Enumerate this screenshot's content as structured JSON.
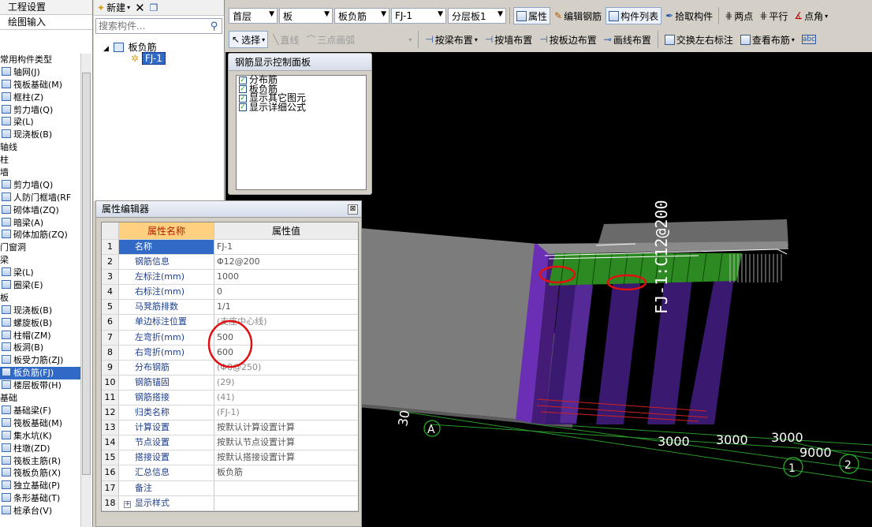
{
  "left_panel": {
    "tabs": [
      "工程设置",
      "绘图输入"
    ],
    "items": [
      {
        "label": "常用构件类型",
        "type": "cat"
      },
      {
        "label": "轴网(J)",
        "type": "item"
      },
      {
        "label": "筏板基础(M)",
        "type": "item"
      },
      {
        "label": "框柱(Z)",
        "type": "item"
      },
      {
        "label": "剪力墙(Q)",
        "type": "item"
      },
      {
        "label": "梁(L)",
        "type": "item"
      },
      {
        "label": "现浇板(B)",
        "type": "item"
      },
      {
        "label": "轴线",
        "type": "cat"
      },
      {
        "label": "柱",
        "type": "cat"
      },
      {
        "label": "墙",
        "type": "cat"
      },
      {
        "label": "剪力墙(Q)",
        "type": "item"
      },
      {
        "label": "人防门框墙(RF",
        "type": "item"
      },
      {
        "label": "砌体墙(ZQ)",
        "type": "item"
      },
      {
        "label": "暗梁(A)",
        "type": "item"
      },
      {
        "label": "砌体加筋(ZQ)",
        "type": "item"
      },
      {
        "label": "门窗洞",
        "type": "cat"
      },
      {
        "label": "梁",
        "type": "cat"
      },
      {
        "label": "梁(L)",
        "type": "item"
      },
      {
        "label": "圈梁(E)",
        "type": "item"
      },
      {
        "label": "板",
        "type": "cat"
      },
      {
        "label": "现浇板(B)",
        "type": "item"
      },
      {
        "label": "螺旋板(B)",
        "type": "item"
      },
      {
        "label": "柱帽(ZM)",
        "type": "item"
      },
      {
        "label": "板洞(B)",
        "type": "item"
      },
      {
        "label": "板受力筋(ZJ)",
        "type": "item"
      },
      {
        "label": "板负筋(FJ)",
        "type": "item",
        "selected": true
      },
      {
        "label": "楼层板带(H)",
        "type": "item"
      },
      {
        "label": "基础",
        "type": "cat"
      },
      {
        "label": "基础梁(F)",
        "type": "item"
      },
      {
        "label": "筏板基础(M)",
        "type": "item"
      },
      {
        "label": "集水坑(K)",
        "type": "item"
      },
      {
        "label": "柱墩(ZD)",
        "type": "item"
      },
      {
        "label": "筏板主筋(R)",
        "type": "item"
      },
      {
        "label": "筏板负筋(X)",
        "type": "item"
      },
      {
        "label": "独立基础(P)",
        "type": "item"
      },
      {
        "label": "条形基础(T)",
        "type": "item"
      },
      {
        "label": "桩承台(V)",
        "type": "item"
      }
    ]
  },
  "tree_panel": {
    "new_label": "新建",
    "search_placeholder": "搜索构件...",
    "root": "板负筋",
    "child": "FJ-1"
  },
  "toolbar1": {
    "floor": "首层",
    "type": "板",
    "subtype": "板负筋",
    "component": "FJ-1",
    "layer": "分层板1",
    "attributes": "属性",
    "edit_rebar": "编辑钢筋",
    "component_list": "构件列表",
    "pick_component": "拾取构件",
    "two_points": "两点",
    "parallel": "平行",
    "point_angle": "点角"
  },
  "toolbar2": {
    "select": "选择",
    "line": "直线",
    "arc": "三点画弧",
    "by_beam": "按梁布置",
    "by_wall": "按墙布置",
    "by_slab_edge": "按板边布置",
    "draw_line": "画线布置",
    "swap_marks": "交换左右标注",
    "view_layout": "查看布筋"
  },
  "rebar_panel": {
    "title": "钢筋显示控制面板",
    "options": [
      "分布筋",
      "板负筋",
      "显示其它图元",
      "显示详细公式"
    ]
  },
  "property_editor": {
    "title": "属性编辑器",
    "col_name": "属性名称",
    "col_value": "属性值",
    "rows": [
      {
        "n": "1",
        "k": "名称",
        "v": "FJ-1",
        "sel": true
      },
      {
        "n": "2",
        "k": "钢筋信息",
        "v": "Φ12@200"
      },
      {
        "n": "3",
        "k": "左标注(mm)",
        "v": "1000"
      },
      {
        "n": "4",
        "k": "右标注(mm)",
        "v": "0"
      },
      {
        "n": "5",
        "k": "马凳筋排数",
        "v": "1/1"
      },
      {
        "n": "6",
        "k": "单边标注位置",
        "v": "(支座中心线)",
        "gray": true
      },
      {
        "n": "7",
        "k": "左弯折(mm)",
        "v": "500"
      },
      {
        "n": "8",
        "k": "右弯折(mm)",
        "v": "600"
      },
      {
        "n": "9",
        "k": "分布钢筋",
        "v": "(Φ8@250)",
        "gray": true
      },
      {
        "n": "10",
        "k": "钢筋锚固",
        "v": "(29)",
        "gray": true
      },
      {
        "n": "11",
        "k": "钢筋搭接",
        "v": "(41)",
        "gray": true
      },
      {
        "n": "12",
        "k": "归类名称",
        "v": "(FJ-1)",
        "gray": true
      },
      {
        "n": "13",
        "k": "计算设置",
        "v": "按默认计算设置计算"
      },
      {
        "n": "14",
        "k": "节点设置",
        "v": "按默认节点设置计算"
      },
      {
        "n": "15",
        "k": "搭接设置",
        "v": "按默认搭接设置计算"
      },
      {
        "n": "16",
        "k": "汇总信息",
        "v": "板负筋"
      },
      {
        "n": "17",
        "k": "备注",
        "v": ""
      },
      {
        "n": "18",
        "k": "显示样式",
        "v": "",
        "expand": true
      }
    ]
  },
  "viewport": {
    "rebar_label": "FJ-1:C12@200",
    "dims": [
      "3000",
      "3000",
      "3000",
      "9000",
      "30"
    ],
    "axes": [
      "A",
      "1",
      "2"
    ]
  }
}
